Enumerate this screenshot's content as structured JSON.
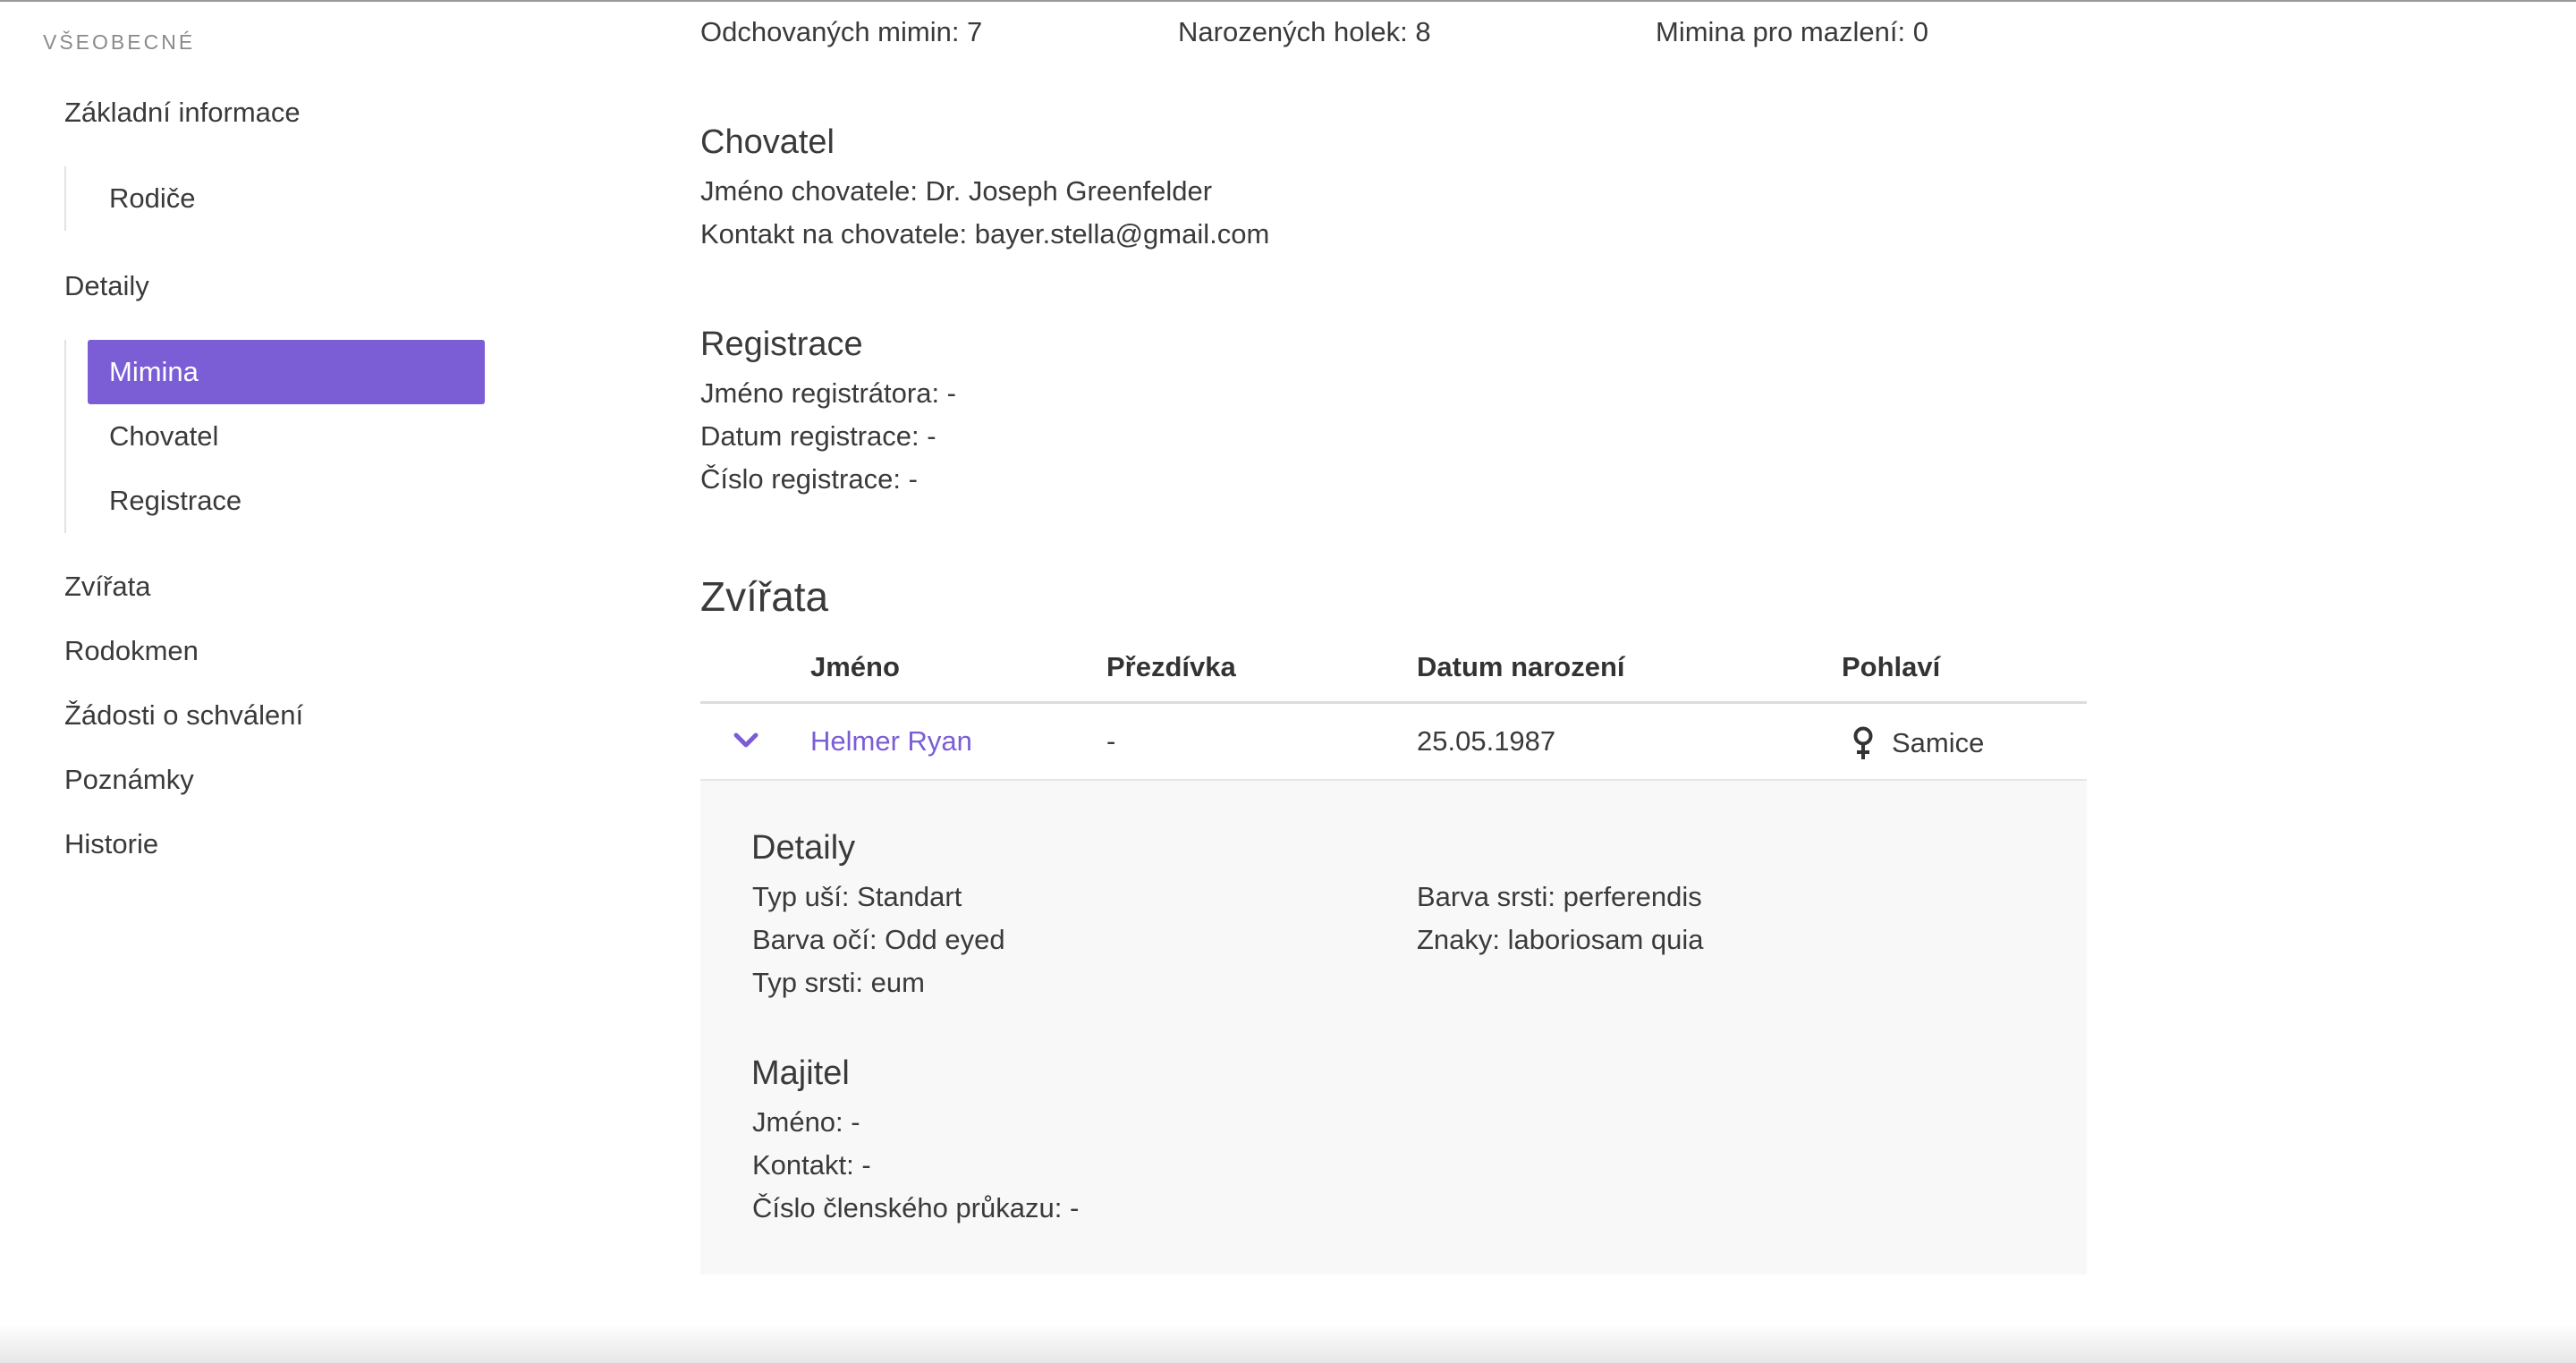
{
  "sidebar": {
    "section_heading": "VŠEOBECNÉ",
    "items": [
      {
        "label": "Základní informace"
      },
      {
        "label": "Rodiče"
      },
      {
        "label": "Detaily"
      },
      {
        "label": "Mimina",
        "active": true
      },
      {
        "label": "Chovatel"
      },
      {
        "label": "Registrace"
      },
      {
        "label": "Zvířata"
      },
      {
        "label": "Rodokmen"
      },
      {
        "label": "Žádosti o schválení"
      },
      {
        "label": "Poznámky"
      },
      {
        "label": "Historie"
      }
    ]
  },
  "stats": {
    "raised": "Odchovaných mimin: 7",
    "girls_born": "Narozených holek: 8",
    "for_cuddling": "Mimina pro mazlení: 0"
  },
  "breeder": {
    "title": "Chovatel",
    "name": "Jméno chovatele: Dr. Joseph Greenfelder",
    "contact": "Kontakt na chovatele: bayer.stella@gmail.com"
  },
  "registration": {
    "title": "Registrace",
    "registrar": "Jméno registrátora: -",
    "date": "Datum registrace: -",
    "number": "Číslo registrace: -"
  },
  "animals": {
    "title": "Zvířata",
    "columns": [
      "Jméno",
      "Přezdívka",
      "Datum narození",
      "Pohlaví"
    ],
    "rows": [
      {
        "name": "Helmer Ryan",
        "nickname": "-",
        "birth_date": "25.05.1987",
        "sex": "Samice",
        "sex_icon": "female-icon"
      }
    ],
    "expanded": {
      "details_title": "Detaily",
      "ear_type": "Typ uší: Standart",
      "eye_color": "Barva očí: Odd eyed",
      "coat_type": "Typ srsti: eum",
      "coat_color": "Barva srsti: perferendis",
      "markings": "Znaky: laboriosam quia",
      "owner_title": "Majitel",
      "owner_name": "Jméno: -",
      "owner_contact": "Kontakt: -",
      "membership_number": "Číslo členského průkazu: -"
    }
  },
  "colors": {
    "accent": "#7b5dd6"
  }
}
